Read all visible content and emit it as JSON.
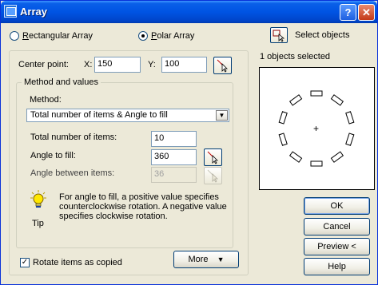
{
  "window": {
    "title": "Array",
    "help_btn": "?",
    "close_btn": "✕"
  },
  "array_type": {
    "rectangular": "Rectangular Array",
    "rectangular_key": "R",
    "polar": "Polar Array",
    "polar_key": "P",
    "selected": "Polar Array"
  },
  "select_objects": {
    "label": "Select objects",
    "status": "1 objects selected"
  },
  "center_point": {
    "label": "Center point:",
    "x_label": "X:",
    "x_value": "150",
    "y_label": "Y:",
    "y_value": "100"
  },
  "method_group": {
    "title": "Method and values",
    "method_label": "Method:",
    "method_value": "Total number of items & Angle to fill",
    "items_label": "Total number of items:",
    "items_value": "10",
    "fill_label": "Angle to fill:",
    "fill_value": "360",
    "between_label": "Angle between items:",
    "between_value": "36"
  },
  "tip": {
    "caption": "Tip",
    "text": "For angle to fill, a positive value specifies counterclockwise rotation.  A negative value specifies clockwise rotation."
  },
  "rotate_items": {
    "label": "Rotate items as copied",
    "checked": true
  },
  "buttons": {
    "more": "More",
    "more_icon": "▼",
    "ok": "OK",
    "cancel": "Cancel",
    "preview": "Preview <",
    "help": "Help"
  },
  "preview_items": {
    "count": 10,
    "center_mark": "+"
  }
}
